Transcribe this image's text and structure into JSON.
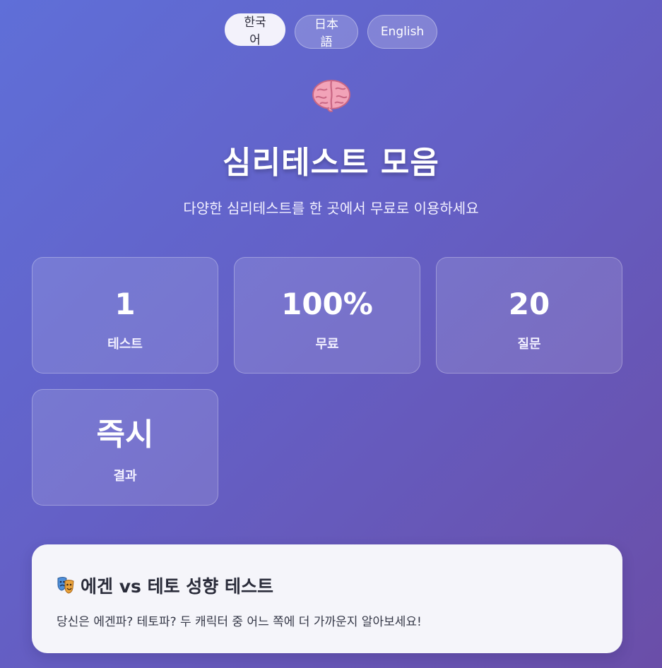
{
  "languages": [
    {
      "label": "한국어",
      "active": true
    },
    {
      "label": "日本語",
      "active": false
    },
    {
      "label": "English",
      "active": false
    }
  ],
  "hero": {
    "icon": "brain-icon",
    "title": "심리테스트 모음",
    "subtitle": "다양한 심리테스트를 한 곳에서 무료로 이용하세요"
  },
  "stats": [
    {
      "value": "1",
      "label": "테스트"
    },
    {
      "value": "100%",
      "label": "무료"
    },
    {
      "value": "20",
      "label": "질문"
    },
    {
      "value": "즉시",
      "label": "결과"
    }
  ],
  "tests": [
    {
      "icon": "theater-masks-icon",
      "title": "에겐 vs 테토 성향 테스트",
      "description": "당신은 에겐파? 테토파? 두 캐릭터 중 어느 쪽에 더 가까운지 알아보세요!"
    }
  ],
  "colors": {
    "background_start": "#5f6fd8",
    "background_end": "#6a4ea8",
    "card_bg": "#f5f5fa",
    "active_lang_bg": "#f3f2fb"
  }
}
